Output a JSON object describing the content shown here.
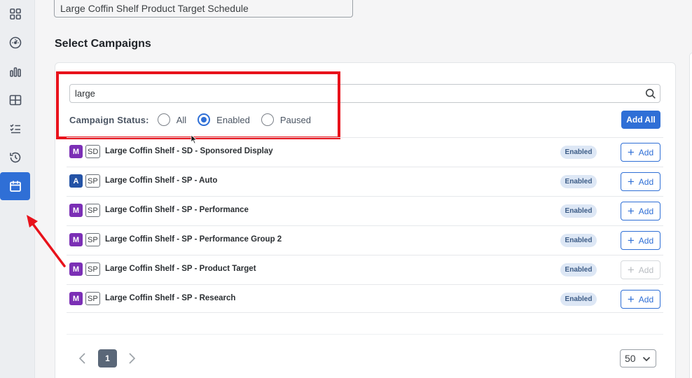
{
  "schedule": {
    "name": "Large Coffin Shelf Product Target Schedule"
  },
  "section": {
    "title": "Select Campaigns"
  },
  "search": {
    "value": "large"
  },
  "filter": {
    "label": "Campaign Status:",
    "options": [
      "All",
      "Enabled",
      "Paused"
    ],
    "selected": "Enabled"
  },
  "actions": {
    "add_all": "Add All",
    "add": "Add"
  },
  "campaigns": [
    {
      "type": "M",
      "kind": "SD",
      "name": "Large Coffin Shelf - SD - Sponsored Display",
      "status": "Enabled",
      "add_enabled": true
    },
    {
      "type": "A",
      "kind": "SP",
      "name": "Large Coffin Shelf - SP - Auto",
      "status": "Enabled",
      "add_enabled": true
    },
    {
      "type": "M",
      "kind": "SP",
      "name": "Large Coffin Shelf - SP - Performance",
      "status": "Enabled",
      "add_enabled": true
    },
    {
      "type": "M",
      "kind": "SP",
      "name": "Large Coffin Shelf - SP - Performance Group 2",
      "status": "Enabled",
      "add_enabled": true
    },
    {
      "type": "M",
      "kind": "SP",
      "name": "Large Coffin Shelf - SP - Product Target",
      "status": "Enabled",
      "add_enabled": false
    },
    {
      "type": "M",
      "kind": "SP",
      "name": "Large Coffin Shelf - SP - Research",
      "status": "Enabled",
      "add_enabled": true
    }
  ],
  "pagination": {
    "current_page": "1",
    "page_size": "50"
  },
  "colors": {
    "accent": "#2f6fd6",
    "manual_badge": "#7b2fb5",
    "auto_badge": "#2453a6",
    "highlight": "#e8121b"
  },
  "sidebar": {
    "icons": [
      "grid-icon",
      "dashboard-gauge-icon",
      "bar-chart-icon",
      "table-icon",
      "checklist-icon",
      "history-icon",
      "calendar-icon"
    ],
    "active": "calendar-icon"
  }
}
